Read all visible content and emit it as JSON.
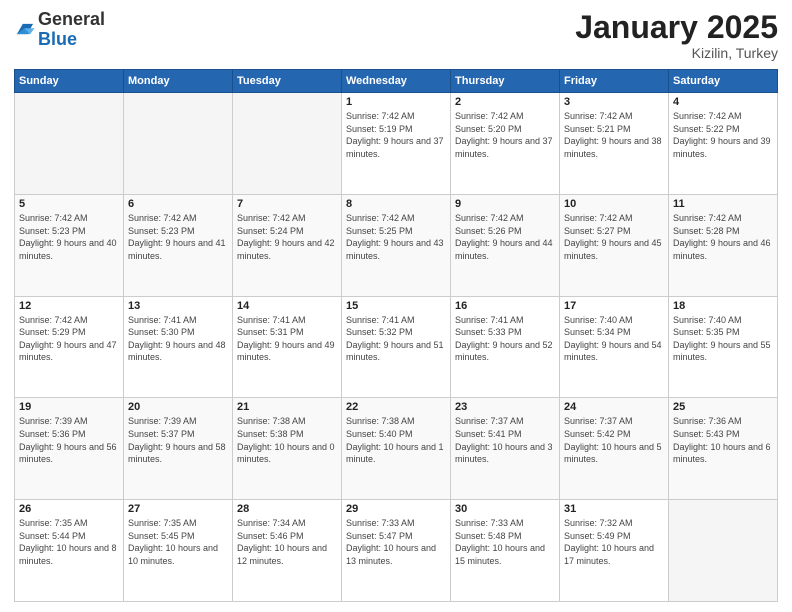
{
  "header": {
    "logo_line1": "General",
    "logo_line2": "Blue",
    "month": "January 2025",
    "location": "Kizilin, Turkey"
  },
  "weekdays": [
    "Sunday",
    "Monday",
    "Tuesday",
    "Wednesday",
    "Thursday",
    "Friday",
    "Saturday"
  ],
  "weeks": [
    [
      {
        "day": "",
        "info": ""
      },
      {
        "day": "",
        "info": ""
      },
      {
        "day": "",
        "info": ""
      },
      {
        "day": "1",
        "info": "Sunrise: 7:42 AM\nSunset: 5:19 PM\nDaylight: 9 hours and 37 minutes."
      },
      {
        "day": "2",
        "info": "Sunrise: 7:42 AM\nSunset: 5:20 PM\nDaylight: 9 hours and 37 minutes."
      },
      {
        "day": "3",
        "info": "Sunrise: 7:42 AM\nSunset: 5:21 PM\nDaylight: 9 hours and 38 minutes."
      },
      {
        "day": "4",
        "info": "Sunrise: 7:42 AM\nSunset: 5:22 PM\nDaylight: 9 hours and 39 minutes."
      }
    ],
    [
      {
        "day": "5",
        "info": "Sunrise: 7:42 AM\nSunset: 5:23 PM\nDaylight: 9 hours and 40 minutes."
      },
      {
        "day": "6",
        "info": "Sunrise: 7:42 AM\nSunset: 5:23 PM\nDaylight: 9 hours and 41 minutes."
      },
      {
        "day": "7",
        "info": "Sunrise: 7:42 AM\nSunset: 5:24 PM\nDaylight: 9 hours and 42 minutes."
      },
      {
        "day": "8",
        "info": "Sunrise: 7:42 AM\nSunset: 5:25 PM\nDaylight: 9 hours and 43 minutes."
      },
      {
        "day": "9",
        "info": "Sunrise: 7:42 AM\nSunset: 5:26 PM\nDaylight: 9 hours and 44 minutes."
      },
      {
        "day": "10",
        "info": "Sunrise: 7:42 AM\nSunset: 5:27 PM\nDaylight: 9 hours and 45 minutes."
      },
      {
        "day": "11",
        "info": "Sunrise: 7:42 AM\nSunset: 5:28 PM\nDaylight: 9 hours and 46 minutes."
      }
    ],
    [
      {
        "day": "12",
        "info": "Sunrise: 7:42 AM\nSunset: 5:29 PM\nDaylight: 9 hours and 47 minutes."
      },
      {
        "day": "13",
        "info": "Sunrise: 7:41 AM\nSunset: 5:30 PM\nDaylight: 9 hours and 48 minutes."
      },
      {
        "day": "14",
        "info": "Sunrise: 7:41 AM\nSunset: 5:31 PM\nDaylight: 9 hours and 49 minutes."
      },
      {
        "day": "15",
        "info": "Sunrise: 7:41 AM\nSunset: 5:32 PM\nDaylight: 9 hours and 51 minutes."
      },
      {
        "day": "16",
        "info": "Sunrise: 7:41 AM\nSunset: 5:33 PM\nDaylight: 9 hours and 52 minutes."
      },
      {
        "day": "17",
        "info": "Sunrise: 7:40 AM\nSunset: 5:34 PM\nDaylight: 9 hours and 54 minutes."
      },
      {
        "day": "18",
        "info": "Sunrise: 7:40 AM\nSunset: 5:35 PM\nDaylight: 9 hours and 55 minutes."
      }
    ],
    [
      {
        "day": "19",
        "info": "Sunrise: 7:39 AM\nSunset: 5:36 PM\nDaylight: 9 hours and 56 minutes."
      },
      {
        "day": "20",
        "info": "Sunrise: 7:39 AM\nSunset: 5:37 PM\nDaylight: 9 hours and 58 minutes."
      },
      {
        "day": "21",
        "info": "Sunrise: 7:38 AM\nSunset: 5:38 PM\nDaylight: 10 hours and 0 minutes."
      },
      {
        "day": "22",
        "info": "Sunrise: 7:38 AM\nSunset: 5:40 PM\nDaylight: 10 hours and 1 minute."
      },
      {
        "day": "23",
        "info": "Sunrise: 7:37 AM\nSunset: 5:41 PM\nDaylight: 10 hours and 3 minutes."
      },
      {
        "day": "24",
        "info": "Sunrise: 7:37 AM\nSunset: 5:42 PM\nDaylight: 10 hours and 5 minutes."
      },
      {
        "day": "25",
        "info": "Sunrise: 7:36 AM\nSunset: 5:43 PM\nDaylight: 10 hours and 6 minutes."
      }
    ],
    [
      {
        "day": "26",
        "info": "Sunrise: 7:35 AM\nSunset: 5:44 PM\nDaylight: 10 hours and 8 minutes."
      },
      {
        "day": "27",
        "info": "Sunrise: 7:35 AM\nSunset: 5:45 PM\nDaylight: 10 hours and 10 minutes."
      },
      {
        "day": "28",
        "info": "Sunrise: 7:34 AM\nSunset: 5:46 PM\nDaylight: 10 hours and 12 minutes."
      },
      {
        "day": "29",
        "info": "Sunrise: 7:33 AM\nSunset: 5:47 PM\nDaylight: 10 hours and 13 minutes."
      },
      {
        "day": "30",
        "info": "Sunrise: 7:33 AM\nSunset: 5:48 PM\nDaylight: 10 hours and 15 minutes."
      },
      {
        "day": "31",
        "info": "Sunrise: 7:32 AM\nSunset: 5:49 PM\nDaylight: 10 hours and 17 minutes."
      },
      {
        "day": "",
        "info": ""
      }
    ]
  ]
}
